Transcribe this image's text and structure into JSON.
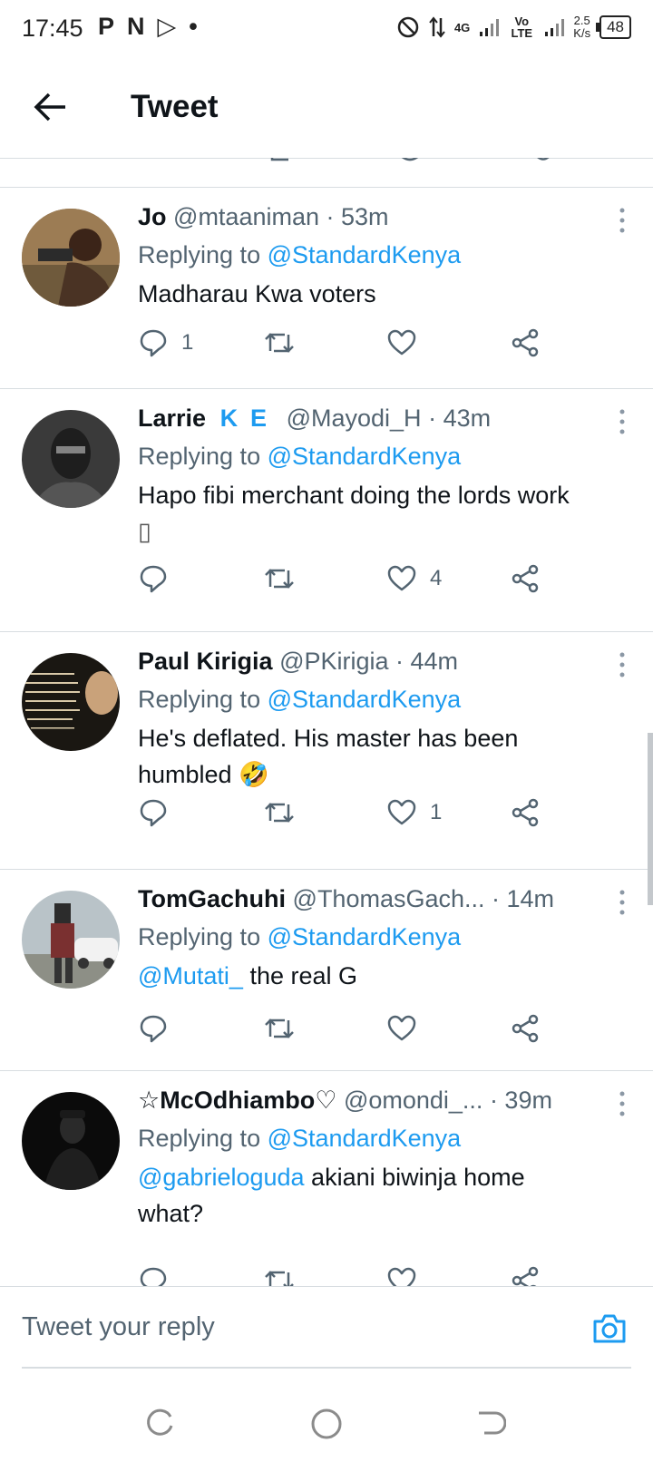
{
  "status_bar": {
    "time": "17:45",
    "app_icons": [
      "P",
      "N",
      "▷",
      "•"
    ],
    "network_1": "4G",
    "network_2": "Vo LTE",
    "speed_value": "2.5",
    "speed_unit": "K/s",
    "battery": "48"
  },
  "header": {
    "title": "Tweet"
  },
  "tweets": [
    {
      "name": "Jo",
      "handle": "@mtaaniman",
      "time": "· 53m",
      "replying_prefix": "Replying to",
      "replying_to": "@StandardKenya",
      "text": "Madharau Kwa voters",
      "reply_count": "1",
      "retweet_count": "",
      "like_count": ""
    },
    {
      "name": "Larrie",
      "name_badge": "KE",
      "handle": "@Mayodi_H",
      "time": "· 43m",
      "replying_prefix": "Replying to",
      "replying_to": "@StandardKenya",
      "text": "Hapo fibi merchant doing the lords work",
      "text_line2": "▯",
      "reply_count": "",
      "retweet_count": "",
      "like_count": "4"
    },
    {
      "name": "Paul Kirigia",
      "handle": "@PKirigia",
      "time": "· 44m",
      "replying_prefix": "Replying to",
      "replying_to": "@StandardKenya",
      "text": "He's deflated. His master has been",
      "text_line2": "humbled 🤣",
      "reply_count": "",
      "retweet_count": "",
      "like_count": "1"
    },
    {
      "name": "TomGachuhi",
      "handle": "@ThomasGach...",
      "time": "· 14m",
      "replying_prefix": "Replying to",
      "replying_to": "@StandardKenya",
      "text_mention": "@Mutati_",
      "text": " the real G",
      "reply_count": "",
      "retweet_count": "",
      "like_count": ""
    },
    {
      "name": "☆McOdhiambo♡",
      "handle": "@omondi_...",
      "time": "· 39m",
      "replying_prefix": "Replying to",
      "replying_to": "@StandardKenya",
      "text_mention": "@gabrieloguda",
      "text": " akiani biwinja home",
      "text_line2": "what?",
      "reply_count": "",
      "retweet_count": "",
      "like_count": ""
    }
  ],
  "reply_bar": {
    "placeholder": "Tweet your reply"
  },
  "colors": {
    "accent": "#1d9bf0",
    "muted": "#536471",
    "divider": "#d8dde1"
  }
}
